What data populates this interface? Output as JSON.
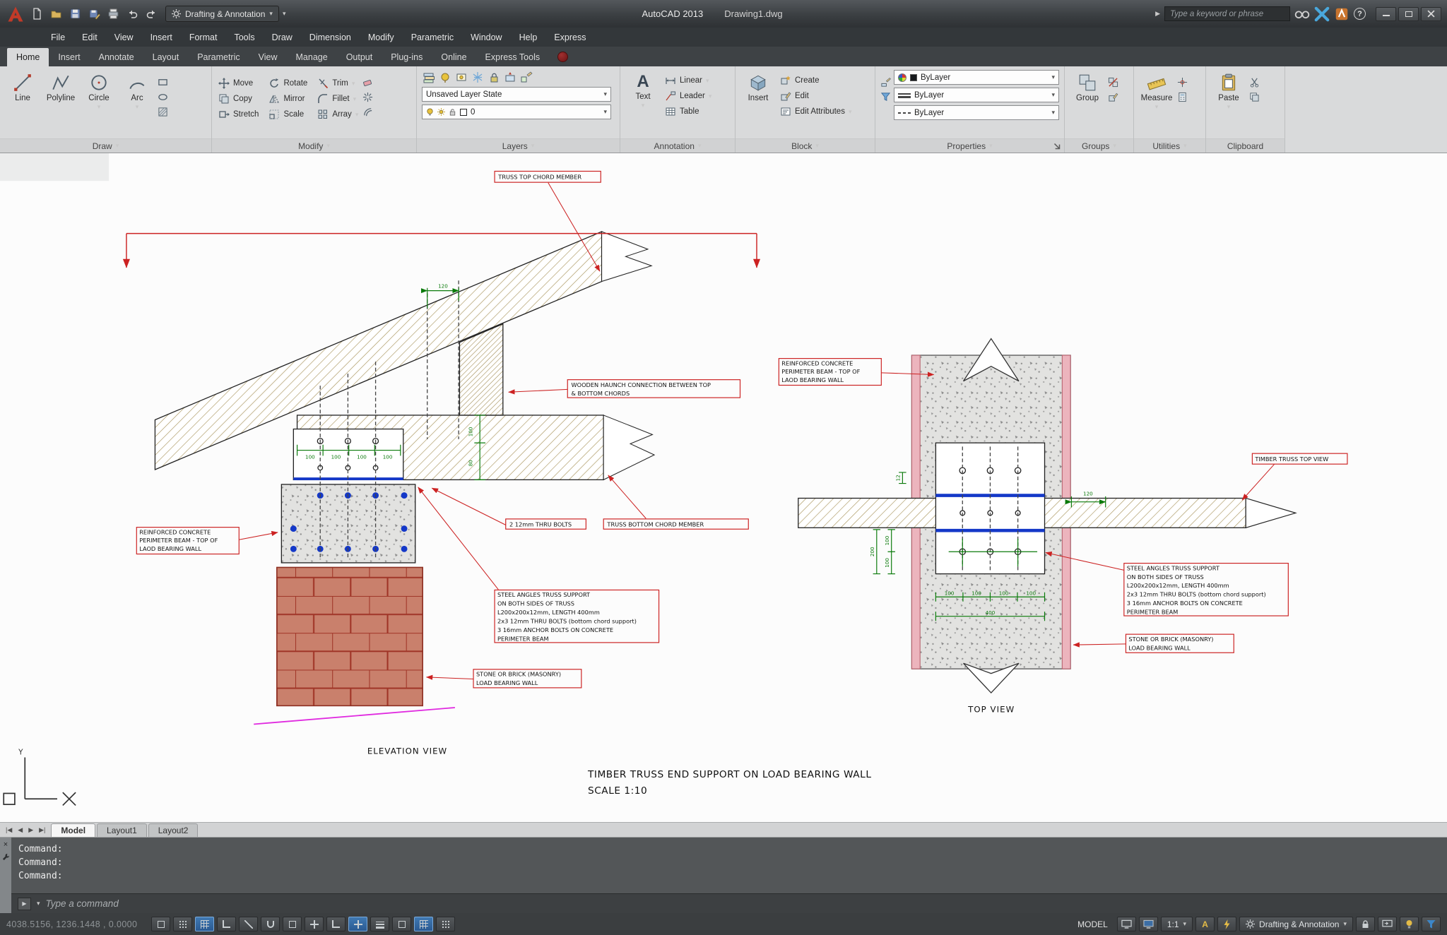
{
  "titlebar": {
    "workspace": "Drafting & Annotation",
    "app": "AutoCAD 2013",
    "doc": "Drawing1.dwg",
    "search_placeholder": "Type a keyword or phrase"
  },
  "menubar": [
    "File",
    "Edit",
    "View",
    "Insert",
    "Format",
    "Tools",
    "Draw",
    "Dimension",
    "Modify",
    "Parametric",
    "Window",
    "Help",
    "Express"
  ],
  "tabs": [
    "Home",
    "Insert",
    "Annotate",
    "Layout",
    "Parametric",
    "View",
    "Manage",
    "Output",
    "Plug-ins",
    "Online",
    "Express Tools"
  ],
  "ribbon": {
    "draw": {
      "title": "Draw",
      "items": [
        "Line",
        "Polyline",
        "Circle",
        "Arc"
      ]
    },
    "modify": {
      "title": "Modify",
      "items": [
        "Move",
        "Rotate",
        "Trim",
        "Copy",
        "Mirror",
        "Fillet",
        "Stretch",
        "Scale",
        "Array"
      ]
    },
    "layers": {
      "title": "Layers",
      "state": "Unsaved Layer State",
      "layer": "0"
    },
    "annotation": {
      "title": "Annotation",
      "big": "Text",
      "items": [
        "Linear",
        "Leader",
        "Table"
      ]
    },
    "block": {
      "title": "Block",
      "big": "Insert",
      "items": [
        "Create",
        "Edit",
        "Edit Attributes"
      ]
    },
    "properties": {
      "title": "Properties",
      "bylayer": "ByLayer"
    },
    "groups": {
      "title": "Groups",
      "big": "Group"
    },
    "utilities": {
      "title": "Utilities",
      "big": "Measure"
    },
    "clipboard": {
      "title": "Clipboard",
      "big": "Paste"
    }
  },
  "drawing": {
    "labels": {
      "truss_top": "TRUSS TOP CHORD MEMBER",
      "haunch1": "WOODEN HAUNCH CONNECTION BETWEEN TOP",
      "haunch2": "& BOTTOM CHORDS",
      "bolts": "2 12mm THRU BOLTS",
      "truss_bottom": "TRUSS BOTTOM CHORD MEMBER",
      "rc1": "REINFORCED CONCRETE",
      "rc2": "PERIMETER BEAM - TOP OF",
      "rc3": "LAOD BEARING WALL",
      "steel1": "STEEL ANGLES TRUSS SUPPORT",
      "steel2": "ON BOTH SIDES OF TRUSS",
      "steel3": "L200x200x12mm, LENGTH 400mm",
      "steel4": "2x3 12mm THRU BOLTS (bottom chord support)",
      "steel5": "3 16mm ANCHOR BOLTS ON CONCRETE",
      "steel6": "PERIMETER BEAM",
      "masonry1": "STONE OR BRICK (MASONRY)",
      "masonry2": "LOAD BEARING WALL",
      "elevation": "ELEVATION VIEW",
      "timber_top_view": "TIMBER TRUSS TOP VIEW",
      "top_view": "TOP VIEW",
      "title": "TIMBER TRUSS END SUPPORT ON LOAD BEARING WALL",
      "scale": "SCALE 1:10",
      "ucs_y": "Y"
    },
    "dims": {
      "d12": "12",
      "d80": "80",
      "d100": "100",
      "d120": "120",
      "d200": "200",
      "d400": "400"
    }
  },
  "layout": {
    "tabs": [
      "Model",
      "Layout1",
      "Layout2"
    ]
  },
  "command": {
    "line": "Command:",
    "placeholder": "Type a command"
  },
  "status": {
    "coords": "4038.5156, 1236.1448 , 0.0000",
    "model": "MODEL",
    "scale": "1:1",
    "workspace": "Drafting & Annotation"
  },
  "icons": {
    "dropdown": "▾",
    "prompt": "▶",
    "help": "?",
    "nav_first": "|◀",
    "nav_prev": "◀",
    "nav_next": "▶",
    "nav_last": "▶|",
    "text_tool": "A",
    "close": "×"
  }
}
